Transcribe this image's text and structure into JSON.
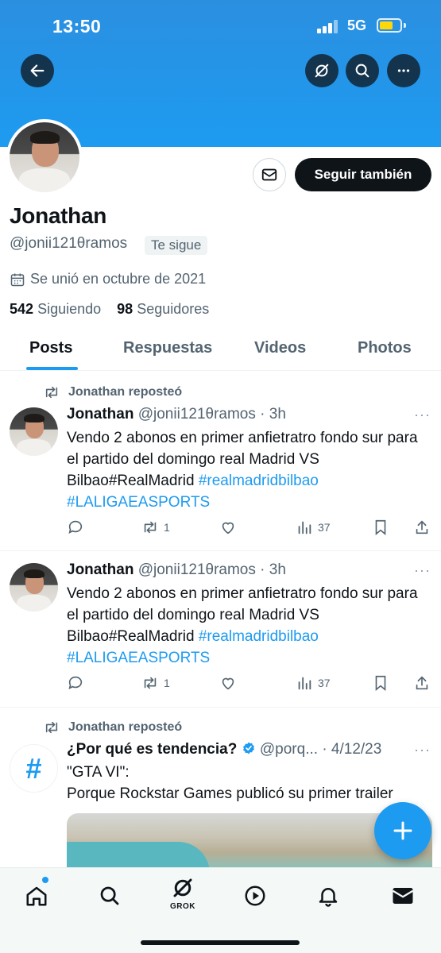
{
  "status_bar": {
    "time": "13:50",
    "network": "5G"
  },
  "profile": {
    "name": "Jonathan",
    "handle": "@jonii121θramos",
    "follows_you": "Te sigue",
    "joined": "Se unió en octubre de 2021",
    "following_count": "542",
    "following_label": "Siguiendo",
    "followers_count": "98",
    "followers_label": "Seguidores",
    "follow_button": "Seguir también"
  },
  "tabs": [
    {
      "label": "Posts",
      "active": true
    },
    {
      "label": "Respuestas",
      "active": false
    },
    {
      "label": "Videos",
      "active": false
    },
    {
      "label": "Photos",
      "active": false
    }
  ],
  "posts": [
    {
      "repost_label": "Jonathan reposteó",
      "author": "Jonathan",
      "meta": "@jonii121θramos · 3h",
      "text_plain": "Vendo 2 abonos en primer anfietratro fondo sur para el partido del domingo real Madrid VS Bilbao#RealMadrid ",
      "tag1": "#realmadridbilbao",
      "tag2": "#LALIGAEASPORTS",
      "reposts": "1",
      "views": "37"
    },
    {
      "author": "Jonathan",
      "meta": "@jonii121θramos · 3h",
      "text_plain": "Vendo 2 abonos en primer anfietratro fondo sur para el partido del domingo real Madrid VS Bilbao#RealMadrid ",
      "tag1": "#realmadridbilbao",
      "tag2": "#LALIGAEASPORTS",
      "reposts": "1",
      "views": "37"
    }
  ],
  "trend_post": {
    "repost_label": "Jonathan reposteó",
    "title": "¿Por qué es tendencia?",
    "meta": "@porq... · 4/12/23",
    "line1": "\"GTA VI\":",
    "line2": "Porque Rockstar Games publicó su primer trailer"
  },
  "bottom_nav": {
    "grok_label": "GROK"
  },
  "colors": {
    "accent": "#1d9bf0",
    "text": "#0f1419",
    "secondary": "#536471"
  }
}
